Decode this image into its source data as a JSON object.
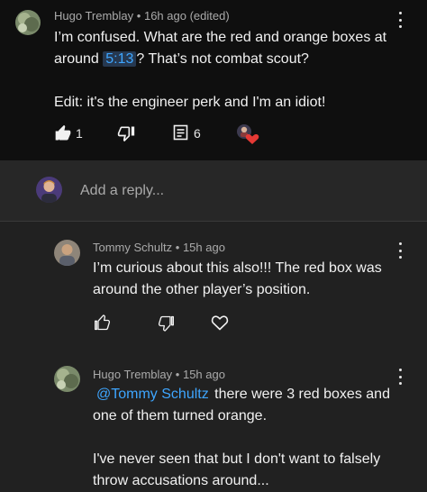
{
  "comment": {
    "author": "Hugo Tremblay",
    "age": "16h ago (edited)",
    "line1": "I’m confused. What are the red and orange boxes at",
    "line2_pre": "around",
    "timestamp": "5:13",
    "line2_post": "? That’s not combat scout?",
    "edit_line": "Edit: it's the engineer perk and I'm an idiot!",
    "likes": "1",
    "replies": "6"
  },
  "reply_box": {
    "placeholder": "Add a reply..."
  },
  "replies": [
    {
      "author": "Tommy Schultz",
      "age": "15h ago",
      "lines": [
        "I’m curious about this also!!! The red box was",
        "around the other player’s position."
      ]
    },
    {
      "author": "Hugo Tremblay",
      "age": "15h ago",
      "mention": "@Tommy Schultz",
      "line1_post": "there were 3 red boxes and",
      "line2": "one of them turned orange.",
      "line3": "I've never seen that but I don't want to falsely",
      "line4": "throw accusations around..."
    }
  ],
  "separator": "•",
  "colors": {
    "link": "#3ea6ff",
    "heart": "#e53935",
    "background": "#212121",
    "top_background": "#0f0f0f"
  },
  "icons": [
    "like-icon",
    "dislike-icon",
    "reply-icon",
    "creator-heart-icon",
    "more-options-icon"
  ]
}
